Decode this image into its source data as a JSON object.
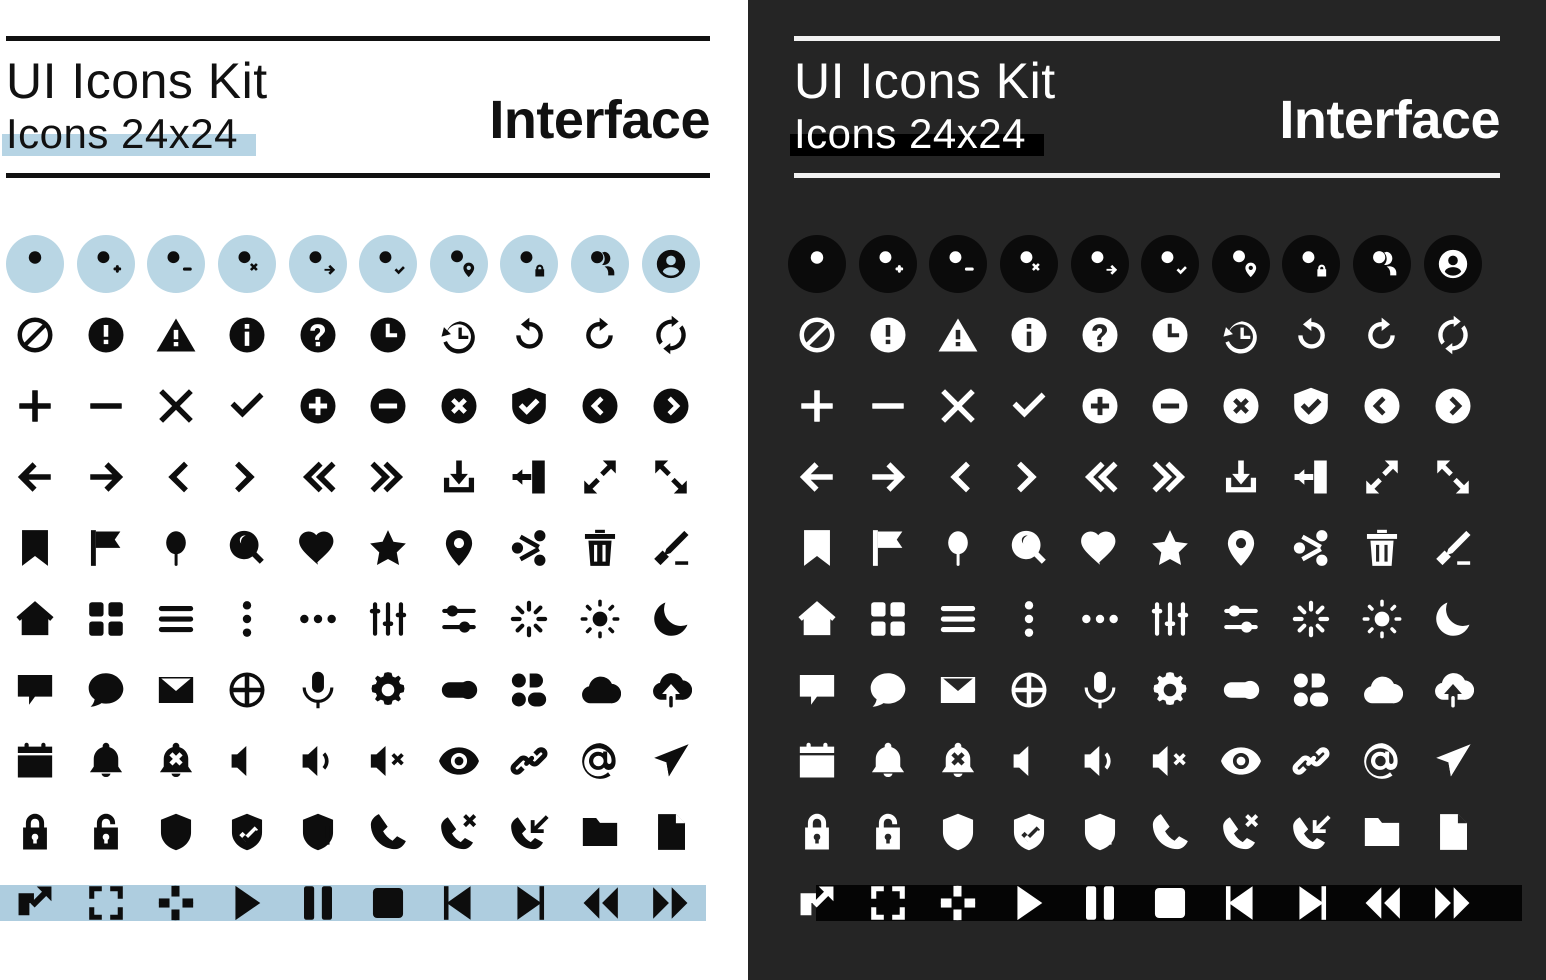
{
  "meta": {
    "panels": [
      "light",
      "dark"
    ],
    "grid_columns": 10,
    "grid_rows": 10,
    "total_icons_per_panel": 100
  },
  "colors": {
    "light_bg": "#ffffff",
    "dark_bg": "#252525",
    "light_accent": "#b9d6e4",
    "light_band": "#aecddf",
    "dark_chip": "#0b0b0b",
    "dark_band": "#050505",
    "light_ink": "#0d0d0d",
    "dark_ink": "#ffffff"
  },
  "header": {
    "title": "UI Icons Kit",
    "subtitle": "Icons 24x24",
    "category": "Interface"
  },
  "icon_rows": [
    {
      "style": "chip",
      "icons": [
        "user-icon",
        "user-add-icon",
        "user-remove-icon",
        "user-x-icon",
        "user-arrow-right-icon",
        "user-check-icon",
        "user-location-icon",
        "user-lock-icon",
        "users-icon",
        "user-circle-icon"
      ]
    },
    {
      "style": "plain",
      "icons": [
        "block-icon",
        "alert-circle-icon",
        "alert-triangle-icon",
        "info-circle-icon",
        "help-circle-icon",
        "clock-icon",
        "clock-history-icon",
        "rotate-ccw-icon",
        "rotate-cw-icon",
        "refresh-icon"
      ]
    },
    {
      "style": "plain",
      "icons": [
        "plus-icon",
        "minus-icon",
        "x-icon",
        "check-icon",
        "plus-circle-icon",
        "minus-circle-icon",
        "x-circle-icon",
        "check-badge-icon",
        "chevron-left-circle-icon",
        "chevron-right-circle-icon"
      ]
    },
    {
      "style": "plain",
      "icons": [
        "arrow-left-icon",
        "arrow-right-icon",
        "chevron-left-icon",
        "chevron-right-icon",
        "chevrons-left-icon",
        "chevrons-right-icon",
        "download-icon",
        "logout-icon",
        "expand-icon",
        "collapse-icon"
      ]
    },
    {
      "style": "plain",
      "icons": [
        "bookmark-icon",
        "flag-icon",
        "pin-icon",
        "search-icon",
        "heart-icon",
        "star-icon",
        "map-pin-icon",
        "share-icon",
        "trash-icon",
        "edit-icon"
      ]
    },
    {
      "style": "plain",
      "icons": [
        "home-icon",
        "grid-icon",
        "menu-icon",
        "more-vertical-icon",
        "more-horizontal-icon",
        "sliders-vertical-icon",
        "sliders-horizontal-icon",
        "loader-icon",
        "sun-icon",
        "moon-icon"
      ]
    },
    {
      "style": "plain",
      "icons": [
        "message-square-icon",
        "message-circle-icon",
        "mail-icon",
        "globe-icon",
        "mic-icon",
        "settings-gear-icon",
        "toggle-icon",
        "layout-blocks-icon",
        "cloud-icon",
        "cloud-upload-icon"
      ]
    },
    {
      "style": "plain",
      "icons": [
        "calendar-icon",
        "bell-icon",
        "bell-off-icon",
        "volume-mute-icon",
        "volume-low-icon",
        "volume-x-icon",
        "eye-icon",
        "link-icon",
        "at-sign-icon",
        "send-icon"
      ]
    },
    {
      "style": "plain",
      "icons": [
        "lock-icon",
        "unlock-icon",
        "shield-icon",
        "shield-check-icon",
        "shield-alert-icon",
        "phone-icon",
        "phone-x-icon",
        "phone-incoming-icon",
        "folder-icon",
        "file-icon"
      ]
    },
    {
      "style": "plain",
      "banded": true,
      "icons": [
        "external-link-icon",
        "fullscreen-icon",
        "minimize-icon",
        "play-icon",
        "pause-icon",
        "stop-icon",
        "skip-back-icon",
        "skip-forward-icon",
        "rewind-icon",
        "fast-forward-icon"
      ]
    }
  ]
}
